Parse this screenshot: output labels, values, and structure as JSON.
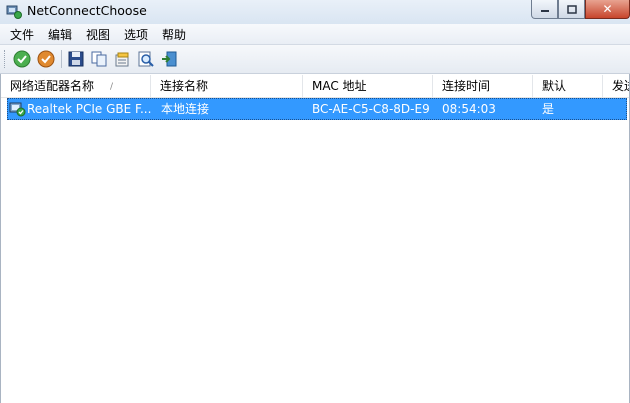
{
  "window": {
    "title": "NetConnectChoose",
    "minimize_icon": "minimize-icon",
    "maximize_icon": "maximize-icon",
    "close_icon": "close-icon"
  },
  "menu": [
    "文件",
    "编辑",
    "视图",
    "选项",
    "帮助"
  ],
  "toolbar": {
    "icons": [
      "enable-connection-icon",
      "disable-connection-icon",
      "save-icon",
      "copy-icon",
      "properties-icon",
      "find-icon",
      "exit-icon"
    ]
  },
  "list": {
    "columns": [
      "网络适配器名称",
      "连接名称",
      "MAC 地址",
      "连接时间",
      "默认",
      "发送"
    ],
    "sort_indicator": "/",
    "rows": [
      {
        "adapter": "Realtek PCIe GBE F...",
        "connection": "本地连接",
        "mac": "BC-AE-C5-C8-8D-E9",
        "time": "08:54:03",
        "default": "是",
        "selected": true
      }
    ]
  },
  "colors": {
    "selection": "#3399ff",
    "titlebar": "#dde8f4",
    "close_button": "#c7452c"
  }
}
